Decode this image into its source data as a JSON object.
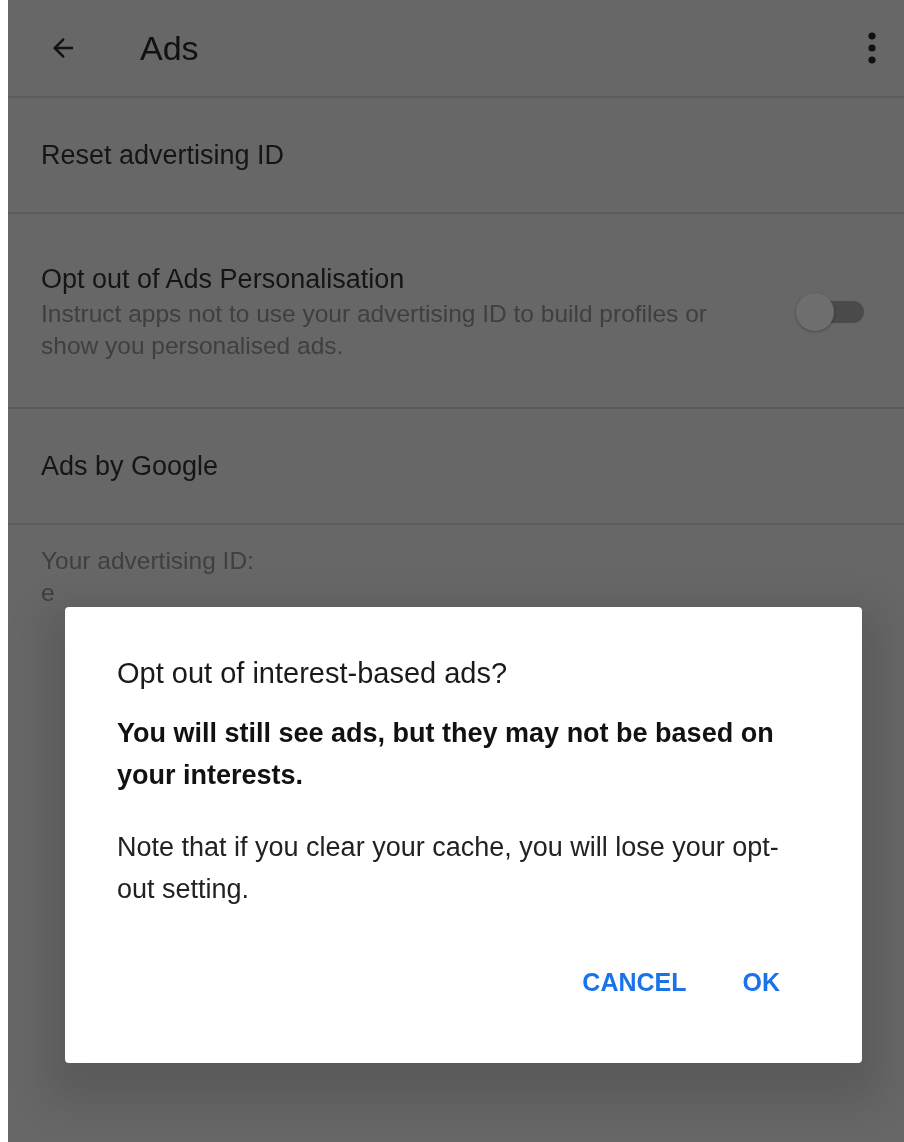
{
  "app_bar": {
    "title": "Ads"
  },
  "settings": [
    {
      "kind": "action",
      "title": "Reset advertising ID"
    },
    {
      "kind": "toggle",
      "title": "Opt out of Ads Personalisation",
      "summary": "Instruct apps not to use your advertising ID to build profiles or show you personalised ads.",
      "on": false
    },
    {
      "kind": "action",
      "title": "Ads by Google"
    },
    {
      "kind": "info",
      "title": "Your advertising ID:",
      "value": "e"
    }
  ],
  "dialog": {
    "title": "Opt out of interest-based ads?",
    "emphasis": "You will still see ads, but they may not be based on your interests.",
    "message": "Note that if you clear your cache, you will lose your opt-out setting.",
    "buttons": [
      "CANCEL",
      "OK"
    ]
  }
}
